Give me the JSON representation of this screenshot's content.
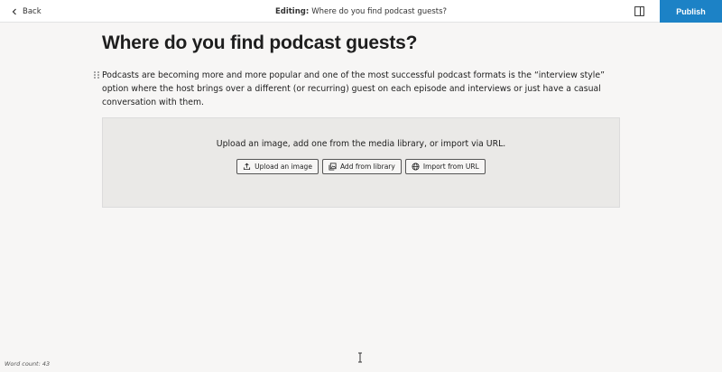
{
  "topbar": {
    "back_label": "Back",
    "editing_label": "Editing:",
    "editing_title": "Where do you find podcast guests?",
    "publish_label": "Publish",
    "accent": "#1c82c6"
  },
  "post": {
    "title": "Where do you find podcast guests?",
    "paragraph": "Podcasts are becoming more and more popular and one of the most successful podcast formats is the “interview style” option where the host brings over a different (or recurring) guest on each episode and interviews or just have a casual conversation with them."
  },
  "image_block": {
    "instructions": "Upload an image, add one from the media library, or import via URL.",
    "buttons": {
      "upload": "Upload an image",
      "library": "Add from library",
      "import": "Import from URL"
    }
  },
  "footer": {
    "word_count": "Word count: 43"
  },
  "icons": [
    "chevron-left-icon",
    "sidebar-panel-icon",
    "upload-icon",
    "media-library-icon",
    "globe-icon",
    "text-cursor-icon",
    "drag-handle-icon"
  ]
}
